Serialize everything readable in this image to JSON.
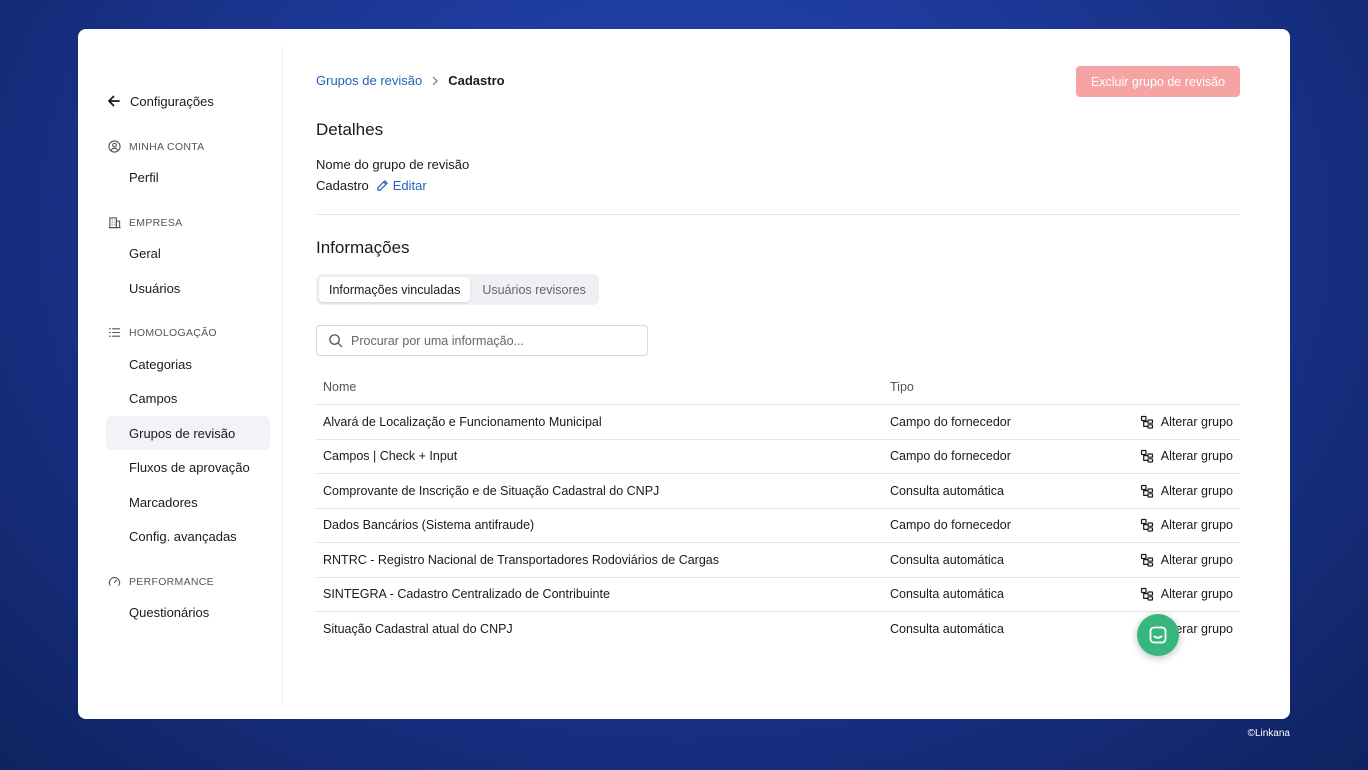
{
  "sidebar": {
    "back_label": "Configurações",
    "sections": [
      {
        "label": "MINHA CONTA",
        "icon": "user-circle-icon",
        "items": [
          "Perfil"
        ]
      },
      {
        "label": "EMPRESA",
        "icon": "building-icon",
        "items": [
          "Geral",
          "Usuários"
        ]
      },
      {
        "label": "HOMOLOGAÇÃO",
        "icon": "list-icon",
        "items": [
          "Categorias",
          "Campos",
          "Grupos de revisão",
          "Fluxos de aprovação",
          "Marcadores",
          "Config. avançadas"
        ]
      },
      {
        "label": "PERFORMANCE",
        "icon": "gauge-icon",
        "items": [
          "Questionários"
        ]
      }
    ],
    "active_item": "Grupos de revisão"
  },
  "breadcrumb": {
    "parent": "Grupos de revisão",
    "current": "Cadastro"
  },
  "delete_button": "Excluir grupo de revisão",
  "details": {
    "heading": "Detalhes",
    "field_label": "Nome do grupo de revisão",
    "field_value": "Cadastro",
    "edit_label": "Editar"
  },
  "info": {
    "heading": "Informações",
    "tabs": [
      {
        "label": "Informações vinculadas",
        "active": true
      },
      {
        "label": "Usuários revisores",
        "active": false
      }
    ],
    "search_placeholder": "Procurar por uma informação...",
    "columns": {
      "name": "Nome",
      "type": "Tipo"
    },
    "action_label": "Alterar grupo",
    "rows": [
      {
        "name": "Alvará de Localização e Funcionamento Municipal",
        "type": "Campo do fornecedor"
      },
      {
        "name": "Campos | Check + Input",
        "type": "Campo do fornecedor"
      },
      {
        "name": "Comprovante de Inscrição e de Situação Cadastral do CNPJ",
        "type": "Consulta automática"
      },
      {
        "name": "Dados Bancários (Sistema antifraude)",
        "type": "Campo do fornecedor"
      },
      {
        "name": "RNTRC - Registro Nacional de Transportadores Rodoviários de Cargas",
        "type": "Consulta automática"
      },
      {
        "name": "SINTEGRA - Cadastro Centralizado de Contribuinte",
        "type": "Consulta automática"
      },
      {
        "name": "Situação Cadastral atual do CNPJ",
        "type": "Consulta automática"
      }
    ]
  },
  "watermark": "©Linkana",
  "colors": {
    "link": "#2363b6",
    "danger_disabled": "#f5a3a3",
    "chat": "#37b77d",
    "active_bg": "#f1f3f6"
  }
}
